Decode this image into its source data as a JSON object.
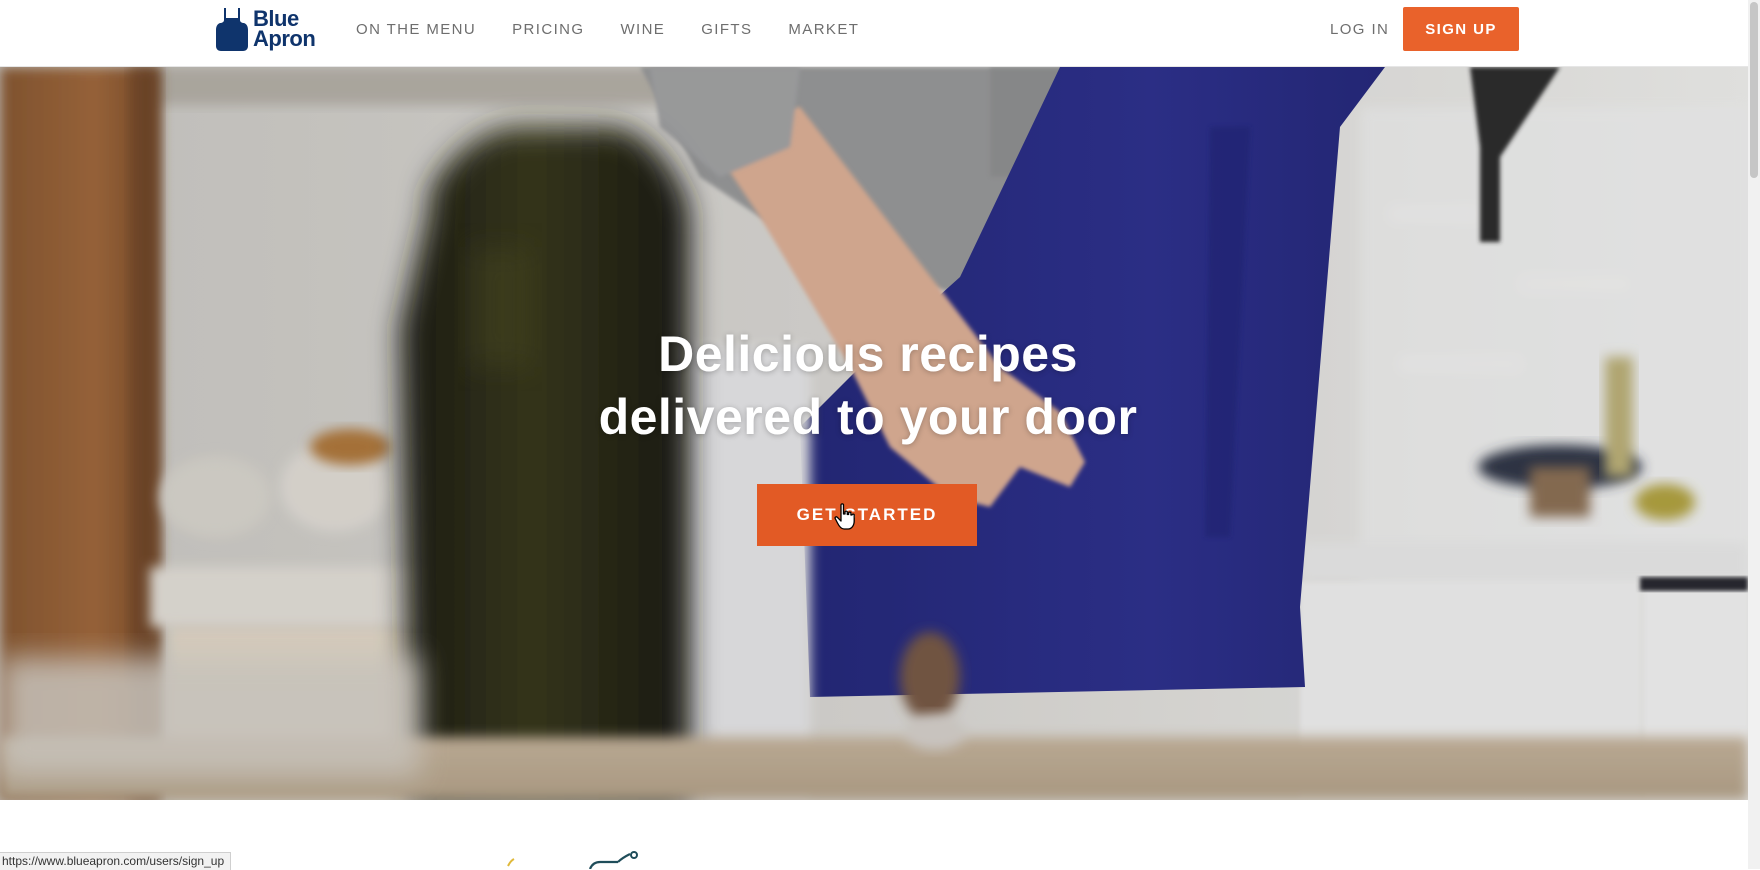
{
  "brand": {
    "name_line1": "Blue",
    "name_line2": "Apron",
    "color": "#0f346c"
  },
  "nav": {
    "items": [
      "ON THE MENU",
      "PRICING",
      "WINE",
      "GIFTS",
      "MARKET"
    ],
    "login_label": "LOG IN",
    "signup_label": "SIGN UP"
  },
  "hero": {
    "title_line1": "Delicious recipes",
    "title_line2": "delivered to your door",
    "cta_label": "GET STARTED"
  },
  "status_bar": {
    "url": "https://www.blueapron.com/users/sign_up"
  },
  "colors": {
    "accent": "#e9622b",
    "cta": "#e25a25",
    "nav_text": "#6e6e6e",
    "apron_blue": "#2c2f8a"
  },
  "icons": [
    "apron-logo-icon",
    "pointer-cursor-icon"
  ]
}
